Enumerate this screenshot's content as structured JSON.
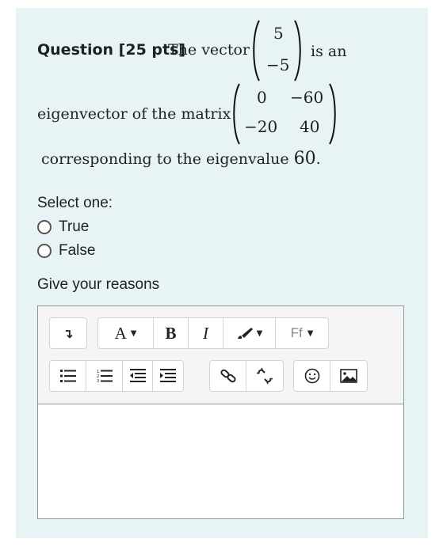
{
  "question": {
    "label": "Question [25 pts]",
    "text_before_vector": "The vector",
    "vector": [
      "5",
      "−5"
    ],
    "text_after_vector": "is an",
    "text_before_matrix": "eigenvector of the matrix",
    "matrix": [
      [
        "0",
        "−60"
      ],
      [
        "−20",
        "40"
      ]
    ],
    "text_after_matrix": "corresponding to the eigenvalue",
    "eigenvalue": "60",
    "period": "."
  },
  "answer": {
    "prompt": "Select one:",
    "options": [
      {
        "label": "True"
      },
      {
        "label": "False"
      }
    ]
  },
  "reasons": {
    "label": "Give your reasons"
  },
  "editor": {
    "toolbar_row1": {
      "collapse_icon": "↴",
      "font_size_label": "A",
      "bold_label": "B",
      "italic_label": "I",
      "font_family_label": "Ff"
    }
  }
}
